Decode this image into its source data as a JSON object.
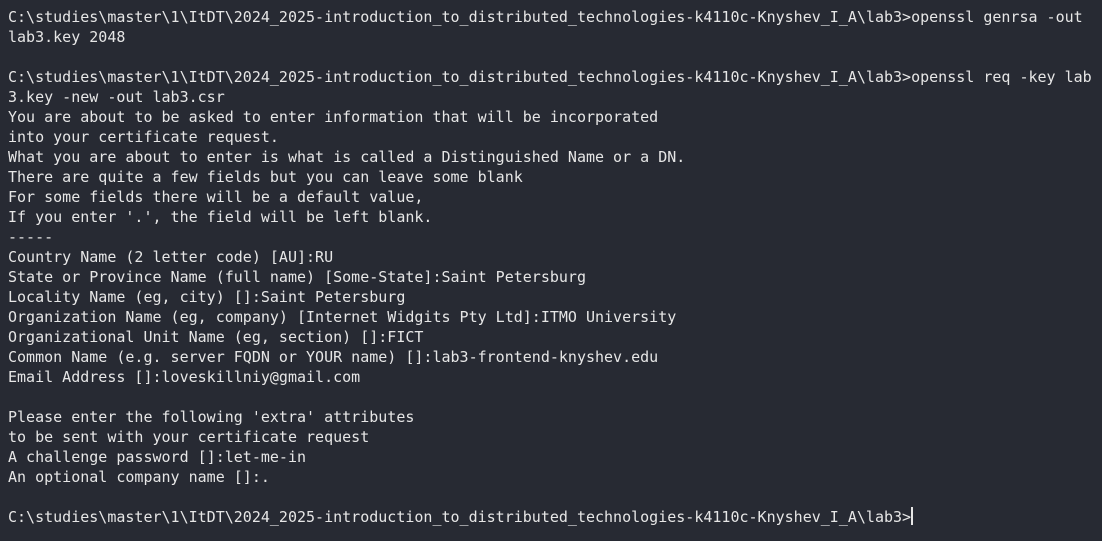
{
  "terminal": {
    "lines": [
      "C:\\studies\\master\\1\\ItDT\\2024_2025-introduction_to_distributed_technologies-k4110c-Knyshev_I_A\\lab3>openssl genrsa -out",
      "lab3.key 2048",
      "",
      "C:\\studies\\master\\1\\ItDT\\2024_2025-introduction_to_distributed_technologies-k4110c-Knyshev_I_A\\lab3>openssl req -key lab",
      "3.key -new -out lab3.csr",
      "You are about to be asked to enter information that will be incorporated",
      "into your certificate request.",
      "What you are about to enter is what is called a Distinguished Name or a DN.",
      "There are quite a few fields but you can leave some blank",
      "For some fields there will be a default value,",
      "If you enter '.', the field will be left blank.",
      "-----",
      "Country Name (2 letter code) [AU]:RU",
      "State or Province Name (full name) [Some-State]:Saint Petersburg",
      "Locality Name (eg, city) []:Saint Petersburg",
      "Organization Name (eg, company) [Internet Widgits Pty Ltd]:ITMO University",
      "Organizational Unit Name (eg, section) []:FICT",
      "Common Name (e.g. server FQDN or YOUR name) []:lab3-frontend-knyshev.edu",
      "Email Address []:loveskillniy@gmail.com",
      "",
      "Please enter the following 'extra' attributes",
      "to be sent with your certificate request",
      "A challenge password []:let-me-in",
      "An optional company name []:.",
      ""
    ],
    "prompt": "C:\\studies\\master\\1\\ItDT\\2024_2025-introduction_to_distributed_technologies-k4110c-Knyshev_I_A\\lab3>"
  }
}
